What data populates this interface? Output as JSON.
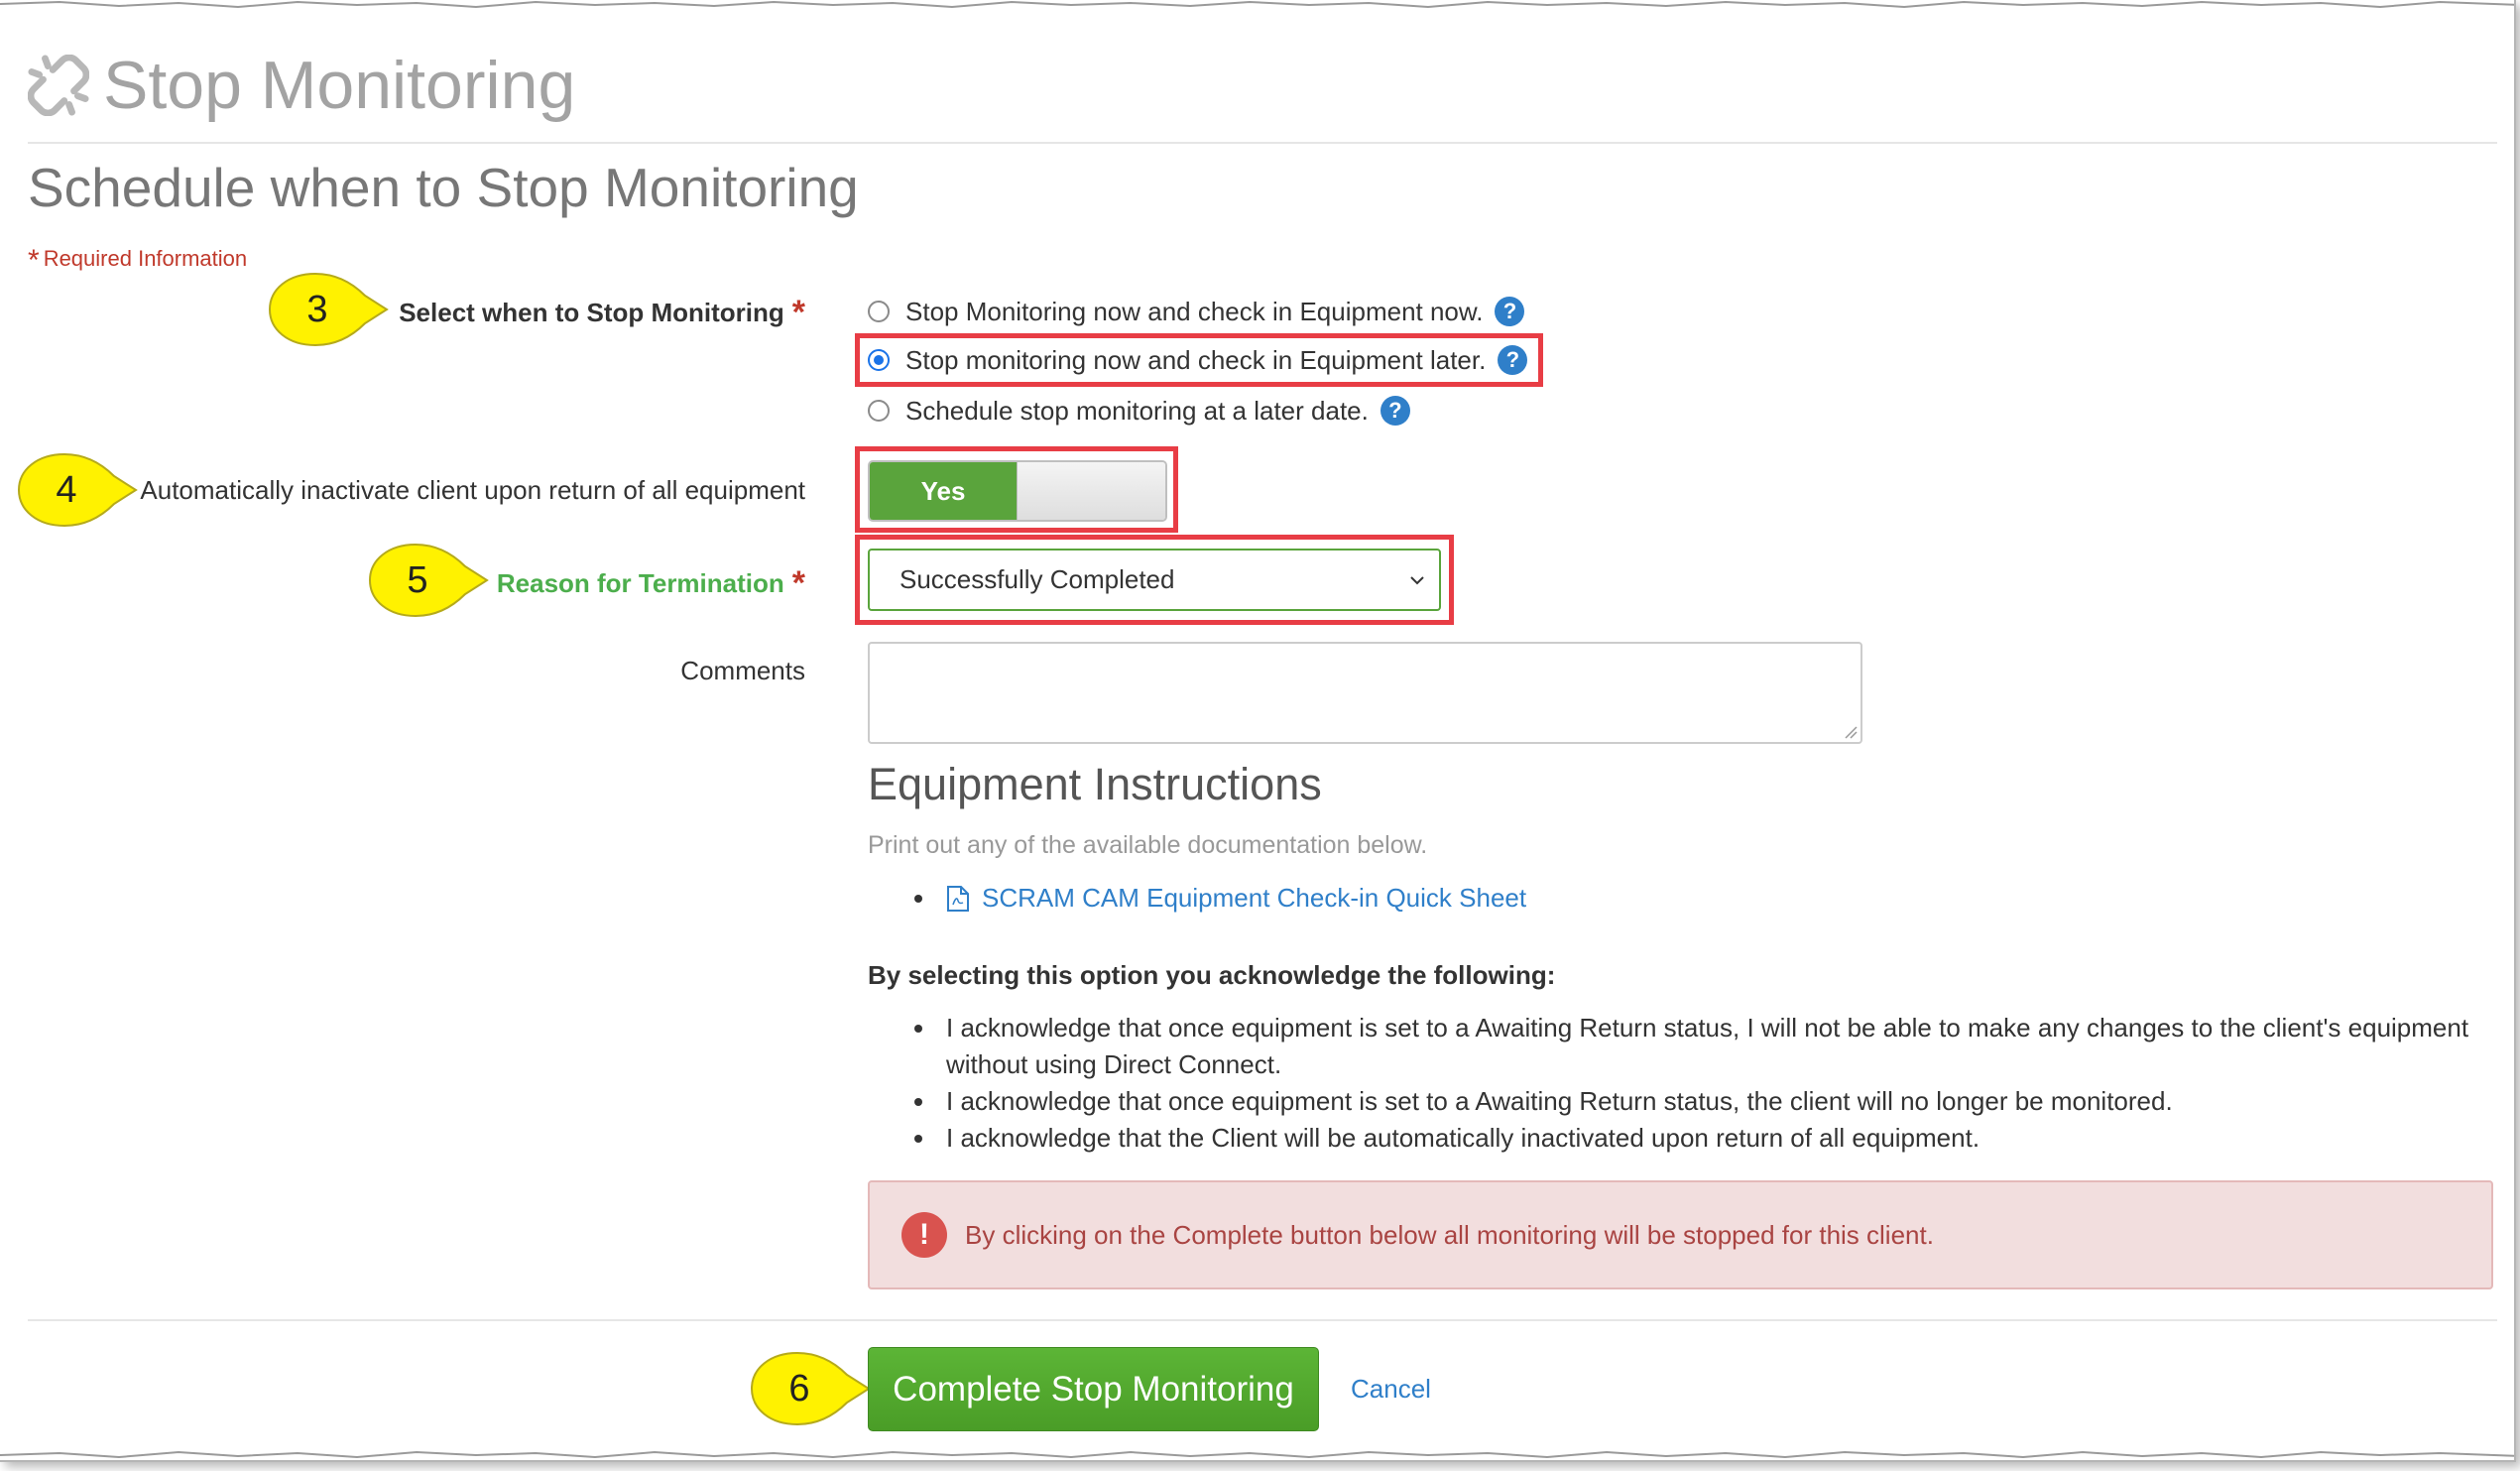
{
  "header": {
    "title": "Stop Monitoring",
    "icon": "broken-link-icon"
  },
  "form": {
    "section_title": "Schedule when to Stop Monitoring",
    "required_info": "Required Information",
    "stop_when": {
      "label": "Select when to Stop Monitoring",
      "options": [
        {
          "label": "Stop Monitoring now and check in Equipment now.",
          "checked": false
        },
        {
          "label": "Stop monitoring now and check in Equipment later.",
          "checked": true
        },
        {
          "label": "Schedule stop monitoring at a later date.",
          "checked": false
        }
      ]
    },
    "auto_inactivate": {
      "label": "Automatically inactivate client upon return of all equipment",
      "toggle_label": "Yes"
    },
    "reason": {
      "label": "Reason for Termination",
      "selected": "Successfully Completed"
    },
    "comments": {
      "label": "Comments",
      "value": ""
    }
  },
  "equipment": {
    "title": "Equipment Instructions",
    "subtitle": "Print out any of the available documentation below.",
    "doc_link": "SCRAM CAM Equipment Check-in Quick Sheet"
  },
  "acknowledge": {
    "title": "By selecting this option you acknowledge the following:",
    "items": [
      "I acknowledge that once equipment is set to a Awaiting Return status, I will not be able to make any changes to the client's equipment without using Direct Connect.",
      "I acknowledge that once equipment is set to a Awaiting Return status, the client will no longer be monitored.",
      "I acknowledge that the Client will be automatically inactivated upon return of all equipment."
    ]
  },
  "alert": {
    "text": "By clicking on the Complete button below all monitoring will be stopped for this client."
  },
  "actions": {
    "complete_label": "Complete Stop Monitoring",
    "cancel_label": "Cancel"
  },
  "callouts": [
    "3",
    "4",
    "5",
    "6"
  ],
  "colors": {
    "required": "#c0392b",
    "primary_green": "#5aa43c",
    "link_blue": "#2f7fc9",
    "highlight_red": "#e83d45",
    "callout_yellow": "#fff200",
    "alert_bg": "#f2dede"
  }
}
